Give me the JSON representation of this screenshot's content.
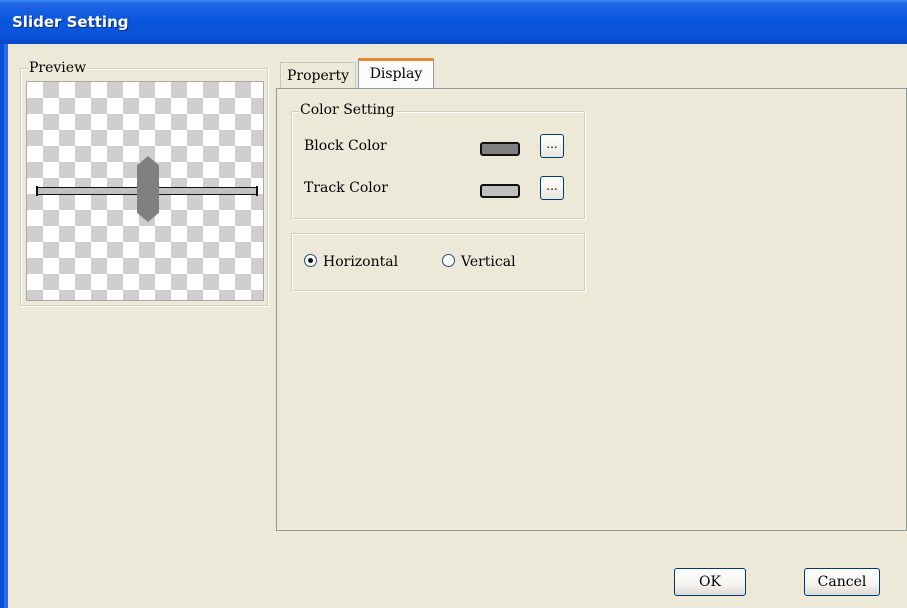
{
  "window": {
    "title": "Slider Setting"
  },
  "preview": {
    "label": "Preview"
  },
  "tabs": [
    {
      "label": "Property"
    },
    {
      "label": "Display"
    }
  ],
  "active_tab": "Display",
  "color_setting": {
    "label": "Color Setting",
    "block_color_label": "Block Color",
    "block_color": "#808080",
    "track_color_label": "Track Color",
    "track_color": "#c0c0c0",
    "picker_label": "..."
  },
  "orientation": {
    "horizontal_label": "Horizontal",
    "vertical_label": "Vertical",
    "selected": "Horizontal"
  },
  "buttons": {
    "ok": "OK",
    "cancel": "Cancel"
  }
}
